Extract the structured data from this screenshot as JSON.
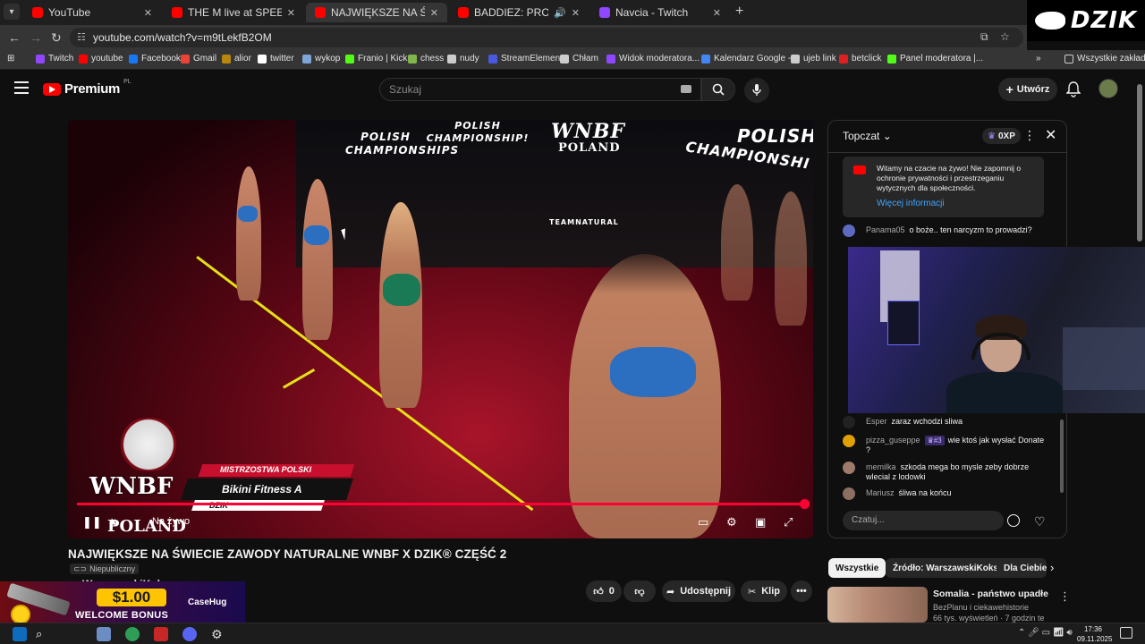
{
  "browser": {
    "tabs": [
      {
        "title": "YouTube",
        "favicon_color": "#ff0000",
        "active": false
      },
      {
        "title": "THE M live at SPEEDLAND FEST",
        "favicon_color": "#ff0000",
        "active": false
      },
      {
        "title": "NAJWIĘKSZE NA ŚWIECIE ZAWO",
        "favicon_color": "#ff0000",
        "active": true
      },
      {
        "title": "BADDIEZ: PROTOKÓŁ BERLI",
        "favicon_color": "#ff0000",
        "active": false
      },
      {
        "title": "Navcia - Twitch",
        "favicon_color": "#9146ff",
        "active": false
      }
    ],
    "url": "youtube.com/watch?v=m9tLekfB2OM",
    "bookmarks": [
      {
        "label": "Twitch",
        "color": "#9146ff"
      },
      {
        "label": "youtube",
        "color": "#ff0000"
      },
      {
        "label": "Facebook",
        "color": "#1877f2"
      },
      {
        "label": "Gmail",
        "color": "#ea4335"
      },
      {
        "label": "alior",
        "color": "#b8860b"
      },
      {
        "label": "twitter",
        "color": "#ffffff"
      },
      {
        "label": "wykop",
        "color": "#7ea6d6"
      },
      {
        "label": "Franio | Kick",
        "color": "#53fc18"
      },
      {
        "label": "chess",
        "color": "#81b64c"
      },
      {
        "label": "nudy",
        "color": "#cccccc"
      },
      {
        "label": "StreamElements",
        "color": "#4a5ae0"
      },
      {
        "label": "Chłam",
        "color": "#cccccc"
      },
      {
        "label": "Widok moderatora...",
        "color": "#9146ff"
      },
      {
        "label": "Kalendarz Google -...",
        "color": "#4285f4"
      },
      {
        "label": "ujeb link",
        "color": "#cccccc"
      },
      {
        "label": "betclick",
        "color": "#e02020"
      },
      {
        "label": "Panel moderatora |...",
        "color": "#53fc18"
      }
    ],
    "all_bookmarks": "Wszystkie zakładki",
    "overlay_logo": "DZIK"
  },
  "youtube": {
    "logo_text": "Premium",
    "logo_region": "PL",
    "search_placeholder": "Szukaj",
    "create_label": "Utwórz",
    "accent": "#ff0000"
  },
  "video": {
    "lower_third": {
      "line1": "MISTRZOSTWA POLSKI",
      "line2": "Bikini Fitness A",
      "line3": "DZIK",
      "logo_wnbf": "WNBF",
      "logo_poland": "POLAND"
    },
    "wall_text": [
      "POLISH CHAMPIONSHIPS",
      "POLISH CHAMPIONSHIP!",
      "WNBF",
      "POLAND",
      "POLISH",
      "CHAMPIONSHI",
      "TEAMNATURAL"
    ],
    "live_label": "Na żywo",
    "progress": 1.0
  },
  "meta": {
    "title": "NAJWIĘKSZE NA ŚWIECIE ZAWODY NATURALNE WNBF X DZIK® CZĘŚĆ 2",
    "visibility": "Niepubliczny",
    "channel": "WarszawskiKoks",
    "likes": "0",
    "share_label": "Udostępnij",
    "clip_label": "Klip"
  },
  "chat": {
    "header": "Topczat",
    "xp": "0XP",
    "welcome": "Witamy na czacie na żywo! Nie zapomnij o ochronie prywatności i przestrzeganiu wytycznych dla społeczności.",
    "welcome_link": "Więcej informacji",
    "messages": [
      {
        "author": "Panama05",
        "text": "o boże.. ten narcyzm to prowadzi?",
        "avatar": "#5c6bc0",
        "badge": ""
      },
      {
        "author": "Esper",
        "text": "zaraz wchodzi sliwa",
        "avatar": "#222222",
        "badge": ""
      },
      {
        "author": "pizza_guseppe",
        "text": "wie ktoś jak wysłać Donate ?",
        "avatar": "#e0a000",
        "badge": "#3"
      },
      {
        "author": "memilka",
        "text": "szkoda mega bo mysle zeby dobrze wlecial z lodowki",
        "avatar": "#9e7a6a",
        "badge": ""
      },
      {
        "author": "Mariusz",
        "text": "śliwa na końcu",
        "avatar": "#8d6e63",
        "badge": ""
      }
    ],
    "input_placeholder": "Czatuj..."
  },
  "suggestions": {
    "chips": [
      "Wszystkie",
      "Źródło: WarszawskiKoks",
      "Dla Ciebie"
    ],
    "card": {
      "title": "Somalia - państwo upadłe",
      "channel": "BezPlanu i ciekawehistorie",
      "meta": "66 tys. wyświetleń · 7 godzin temu"
    }
  },
  "ad": {
    "amount": "$1.00",
    "text": "WELCOME BONUS",
    "brand": "CaseHug"
  },
  "taskbar": {
    "time": "17:36",
    "date": "09.11.2025"
  }
}
